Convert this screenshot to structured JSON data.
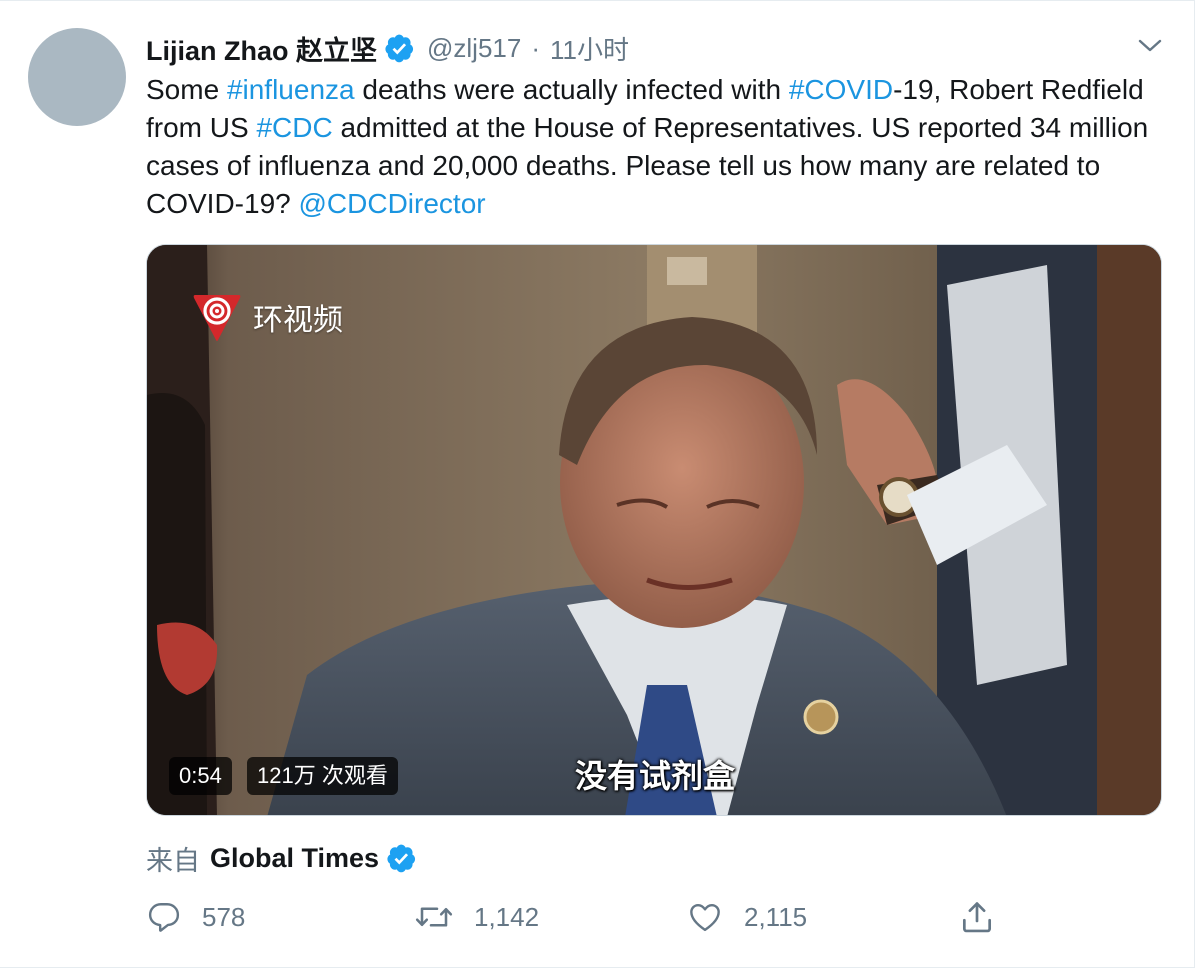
{
  "tweet": {
    "author_name": "Lijian Zhao 赵立坚",
    "handle": "@zlj517",
    "separator": "·",
    "time": "11小时",
    "text": [
      {
        "kind": "plain",
        "value": "Some "
      },
      {
        "kind": "hashtag",
        "value": "#influenza"
      },
      {
        "kind": "plain",
        "value": " deaths were actually infected with "
      },
      {
        "kind": "hashtag",
        "value": "#COVID"
      },
      {
        "kind": "plain",
        "value": "-19, Robert Redfield from US "
      },
      {
        "kind": "hashtag",
        "value": "#CDC"
      },
      {
        "kind": "plain",
        "value": " admitted at the House of Representatives. US reported 34 million cases of influenza and 20,000 deaths. Please tell us how many are related to COVID-19? "
      },
      {
        "kind": "mention",
        "value": "@CDCDirector"
      }
    ]
  },
  "media": {
    "channel_logo_text": "环视频",
    "subtitle": "没有试剂盒",
    "duration": "0:54",
    "views": "121万 次观看"
  },
  "source": {
    "from_label": "来自",
    "name": "Global Times"
  },
  "actions": {
    "reply_count": "578",
    "retweet_count": "1,142",
    "like_count": "2,115"
  },
  "colors": {
    "link": "#1b95e0",
    "verified": "#1da1f2",
    "secondary_text": "#657786"
  },
  "icons": [
    "verified-badge-icon",
    "chevron-down-icon",
    "reply-icon",
    "retweet-icon",
    "like-icon",
    "share-icon",
    "channel-logo-icon"
  ]
}
